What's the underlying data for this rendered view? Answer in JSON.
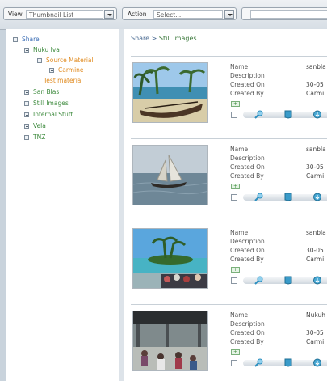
{
  "toolbar": {
    "view_label": "View",
    "view_value": "Thumbnail List",
    "action_label": "Action",
    "action_value": "Select...",
    "search_value": ""
  },
  "tree": {
    "items": [
      {
        "label": "Share",
        "color": "#3d6fb6"
      },
      {
        "label": "Nuku Iva",
        "color": "#3d8a3d"
      },
      {
        "label": "Source Material",
        "color": "#e08a1e"
      },
      {
        "label": "Carmine",
        "color": "#e08a1e"
      },
      {
        "label": "Test material",
        "color": "#e08a1e"
      },
      {
        "label": "San Blas",
        "color": "#3d8a3d"
      },
      {
        "label": "Still Images",
        "color": "#3d8a3d"
      },
      {
        "label": "Internal Stuff",
        "color": "#3d8a3d"
      },
      {
        "label": "Vela",
        "color": "#3d8a3d"
      },
      {
        "label": "TNZ",
        "color": "#3d8a3d"
      }
    ]
  },
  "breadcrumb": {
    "root": "Share",
    "sep": ">",
    "current": "Still Images"
  },
  "fields": {
    "name": "Name",
    "description": "Description",
    "created_on": "Created On",
    "created_by": "Created By"
  },
  "cards": [
    {
      "name": "sanbla",
      "created_on": "30-05",
      "created_by": "Carmi"
    },
    {
      "name": "sanbla",
      "created_on": "30-05",
      "created_by": "Carmi"
    },
    {
      "name": "sanbla",
      "created_on": "30-05",
      "created_by": "Carmi"
    },
    {
      "name": "Nukuh",
      "created_on": "30-05",
      "created_by": "Carmi"
    }
  ],
  "colors": {
    "link": "#4a6a92",
    "green": "#3d7a3d",
    "orange": "#e08a1e",
    "icon_blue": "#2d8fbf"
  }
}
